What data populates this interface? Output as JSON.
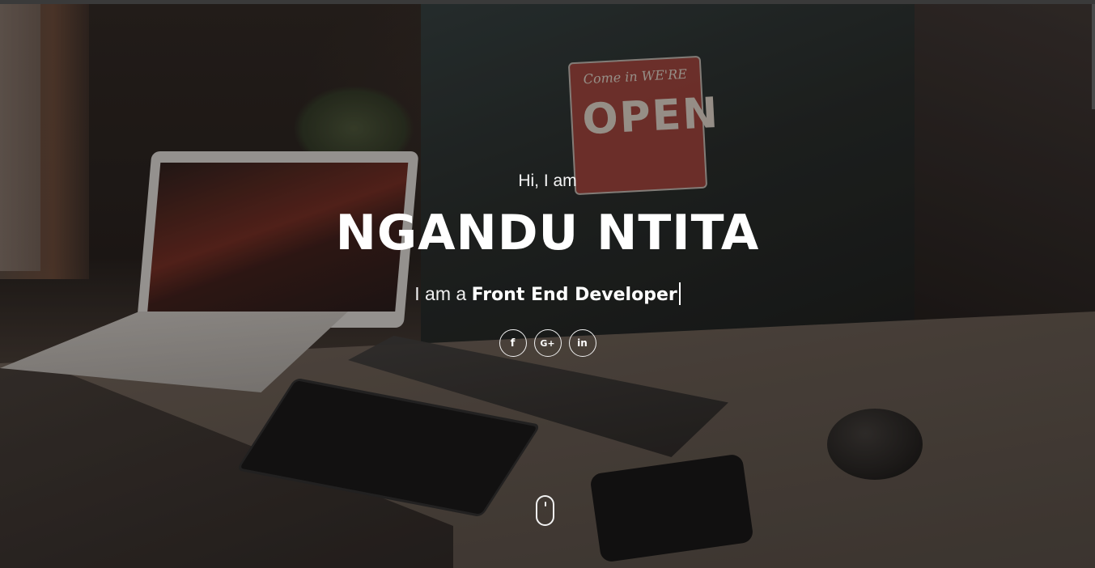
{
  "hero": {
    "greeting": "Hi, I am",
    "name": "NGANDU NTITA",
    "role_prefix": "I am a",
    "role_highlight": "Front End Developer"
  },
  "socials": [
    {
      "icon": "facebook-icon",
      "label": "f"
    },
    {
      "icon": "google-plus-icon",
      "label": "G+"
    },
    {
      "icon": "linkedin-icon",
      "label": "in"
    }
  ],
  "scene": {
    "sign_top": "Come in WE'RE",
    "sign_main": "OPEN"
  },
  "colors": {
    "text": "#ffffff",
    "overlay": "#1e1b19"
  }
}
